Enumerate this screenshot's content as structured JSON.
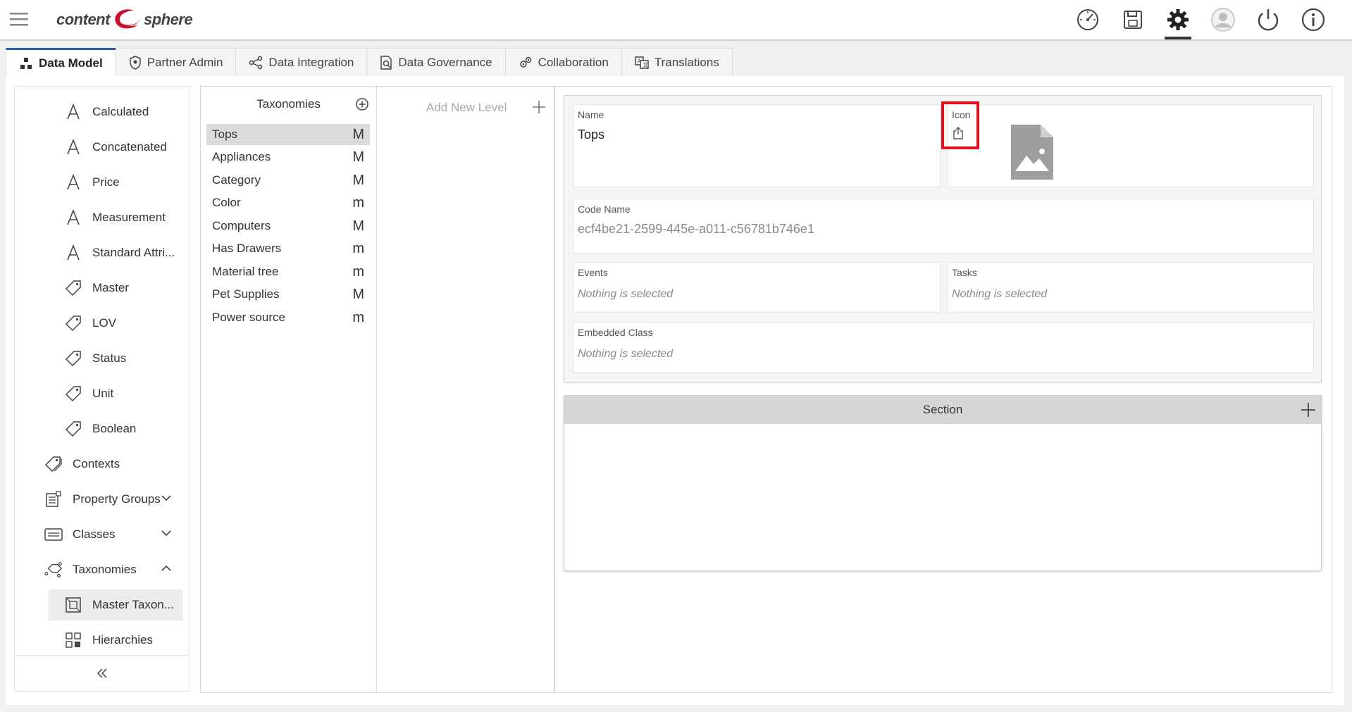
{
  "app": {
    "logo_left": "content",
    "logo_right": "sphere"
  },
  "topbar": {
    "icons": [
      "dashboard-icon",
      "save-icon",
      "gear-icon",
      "user-icon",
      "power-icon",
      "info-icon"
    ],
    "active": "gear-icon"
  },
  "tabs": [
    {
      "label": "Data Model",
      "icon": "data-model-icon",
      "active": true
    },
    {
      "label": "Partner Admin",
      "icon": "shield-icon"
    },
    {
      "label": "Data Integration",
      "icon": "integration-icon"
    },
    {
      "label": "Data Governance",
      "icon": "governance-icon"
    },
    {
      "label": "Collaboration",
      "icon": "collaboration-icon"
    },
    {
      "label": "Translations",
      "icon": "translations-icon"
    }
  ],
  "sidebar": {
    "items": [
      {
        "label": "Calculated",
        "icon": "attribute-a-icon"
      },
      {
        "label": "Concatenated",
        "icon": "attribute-a-icon"
      },
      {
        "label": "Price",
        "icon": "attribute-a-icon"
      },
      {
        "label": "Measurement",
        "icon": "attribute-a-icon"
      },
      {
        "label": "Standard Attri...",
        "icon": "attribute-a-icon"
      },
      {
        "label": "Master",
        "icon": "tag-icon"
      },
      {
        "label": "LOV",
        "icon": "tag-icon"
      },
      {
        "label": "Status",
        "icon": "tag-icon"
      },
      {
        "label": "Unit",
        "icon": "tag-icon"
      },
      {
        "label": "Boolean",
        "icon": "tag-icon"
      },
      {
        "label": "Contexts",
        "icon": "tags-icon"
      },
      {
        "label": "Property Groups",
        "icon": "property-groups-icon"
      },
      {
        "label": "Classes",
        "icon": "classes-icon"
      },
      {
        "label": "Taxonomies",
        "icon": "taxonomy-icon"
      },
      {
        "label": "Master Taxon...",
        "icon": "master-taxonomy-icon"
      },
      {
        "label": "Hierarchies",
        "icon": "hierarchies-icon"
      }
    ]
  },
  "taxonomies": {
    "header": "Taxonomies",
    "items": [
      {
        "label": "Tops",
        "badge": "M"
      },
      {
        "label": "Appliances",
        "badge": "M"
      },
      {
        "label": "Category",
        "badge": "M"
      },
      {
        "label": "Color",
        "badge": "m"
      },
      {
        "label": "Computers",
        "badge": "M"
      },
      {
        "label": "Has Drawers",
        "badge": "m"
      },
      {
        "label": "Material tree",
        "badge": "m"
      },
      {
        "label": "Pet Supplies",
        "badge": "M"
      },
      {
        "label": "Power source",
        "badge": "m"
      }
    ]
  },
  "levels": {
    "add_label": "Add New Level"
  },
  "detail": {
    "name_label": "Name",
    "name_value": "Tops",
    "icon_label": "Icon",
    "code_label": "Code Name",
    "code_value": "ecf4be21-2599-445e-a011-c56781b746e1",
    "events_label": "Events",
    "events_value": "Nothing is selected",
    "tasks_label": "Tasks",
    "tasks_value": "Nothing is selected",
    "embedded_label": "Embedded Class",
    "embedded_value": "Nothing is selected",
    "section_label": "Section"
  },
  "colors": {
    "accent": "#2a5ea8",
    "highlight": "#e0101f",
    "logo_red": "#c8102e"
  }
}
